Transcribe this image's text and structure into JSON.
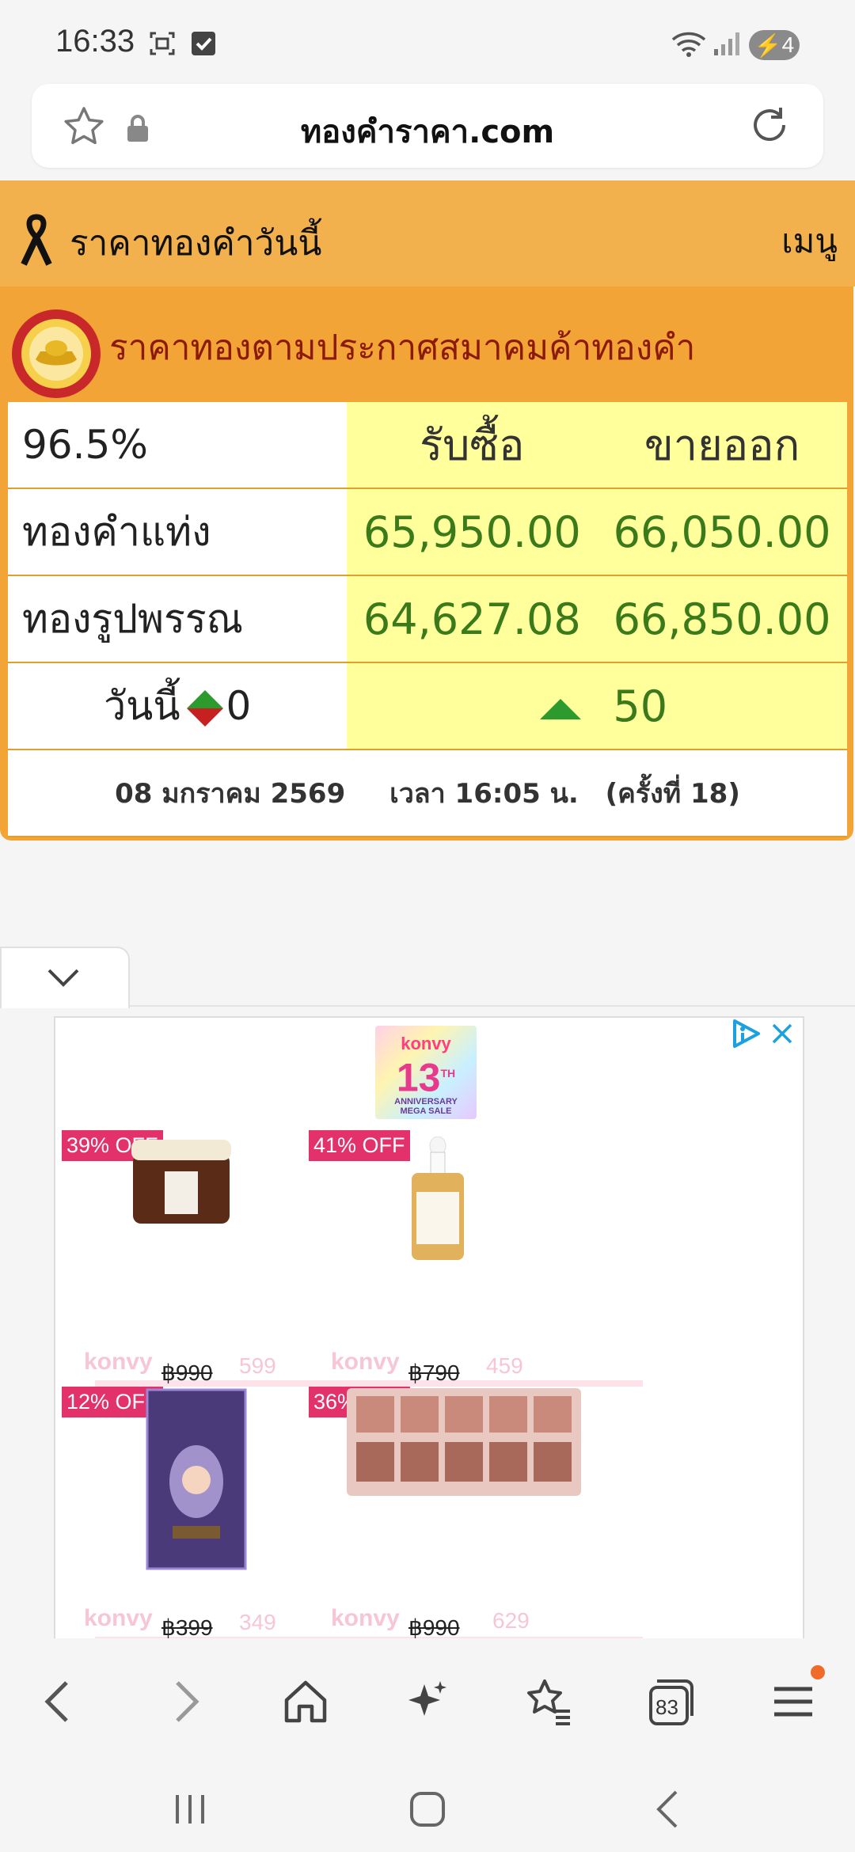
{
  "status_bar": {
    "time": "16:33",
    "battery": "4",
    "icons": [
      "screenshot-icon",
      "check-icon",
      "wifi-icon",
      "signal-icon",
      "battery-icon"
    ]
  },
  "browser": {
    "url": "ทองคำราคา.com"
  },
  "site": {
    "title": "ราคาทองคำวันนี้",
    "menu": "เมนู"
  },
  "gold": {
    "title": "ราคาทองตามประกาศสมาคมค้าทองคำ",
    "purity": "96.5%",
    "buy_header": "รับซื้อ",
    "sell_header": "ขายออก",
    "rows": [
      {
        "label": "ทองคำแท่ง",
        "buy": "65,950.00",
        "sell": "66,050.00"
      },
      {
        "label": "ทองรูปพรรณ",
        "buy": "64,627.08",
        "sell": "66,850.00"
      }
    ],
    "today_label": "วันนี้",
    "today_change": "0",
    "change_value": "50",
    "date": "08 มกราคม 2569",
    "time": "เวลา 16:05 น.",
    "round": "(ครั้งที่ 18)"
  },
  "ad": {
    "banner_brand": "konvy",
    "banner_number": "13",
    "banner_sup": "TH",
    "banner_sub1": "ANNIVERSARY",
    "banner_sub2": "MEGA SALE",
    "products": [
      {
        "badge": "39% OFF",
        "old_price": "฿990",
        "new_price": "599",
        "watermark": "konvy"
      },
      {
        "badge": "41% OFF",
        "old_price": "฿790",
        "new_price": "459",
        "watermark": "konvy"
      },
      {
        "badge": "12% OFF",
        "old_price": "฿399",
        "new_price": "349",
        "watermark": "konvy"
      },
      {
        "badge": "36% OFF",
        "old_price": "฿990",
        "new_price": "629",
        "watermark": "konvy"
      }
    ]
  },
  "toolbar": {
    "tabs_count": "83"
  },
  "colors": {
    "header_orange": "#f2b14d",
    "card_orange": "#f3a437",
    "price_green": "#3a7a1a",
    "value_bg": "#ffff9c",
    "badge_pink": "#e2316b"
  }
}
